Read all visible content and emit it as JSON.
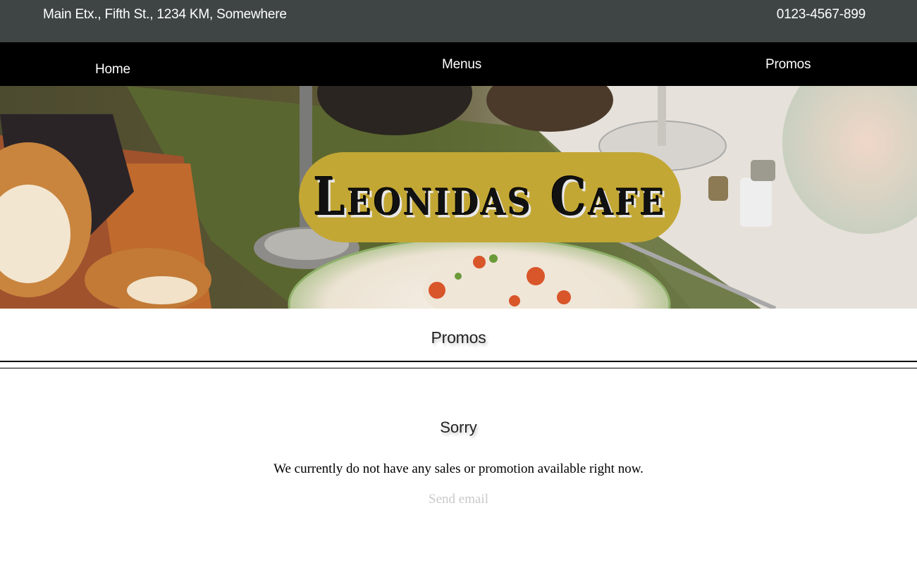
{
  "topbar": {
    "address": "Main Etx., Fifth St., 1234 KM, Somewhere",
    "phone": "0123-4567-899",
    "background": "#3f4545"
  },
  "nav": {
    "items": [
      {
        "label": "Home"
      },
      {
        "label": "Menus"
      },
      {
        "label": "Promos"
      }
    ],
    "background": "#000000"
  },
  "hero": {
    "logo_text": "Leonidas Cafe",
    "logo_pill_color": "#c3a735"
  },
  "main": {
    "section_title": "Promos",
    "heading": "Sorry",
    "message": "We currently do not have any sales or promotion available right now.",
    "link_label": "Send email"
  }
}
